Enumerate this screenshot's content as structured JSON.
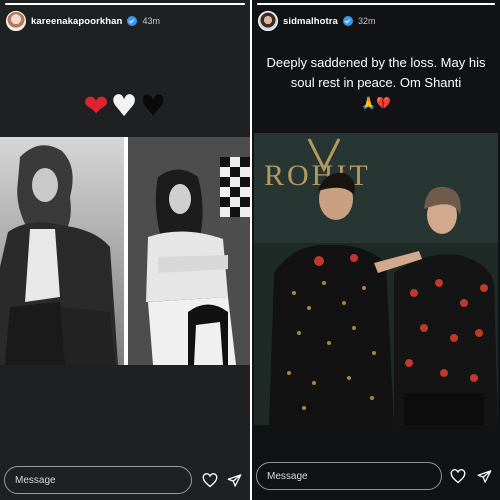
{
  "stories": [
    {
      "username": "kareenakapoorkhan",
      "time": "43m",
      "progress": 1.0,
      "hearts": [
        "❤",
        "♥",
        "♥"
      ],
      "message_placeholder": "Message",
      "icons": [
        "heart-outline-icon",
        "send-icon"
      ]
    },
    {
      "username": "sidmalhotra",
      "time": "32m",
      "progress": 1.0,
      "caption_line1": "Deeply saddened by the loss. May his",
      "caption_line2": "soul rest in peace. Om Shanti",
      "caption_emojis": "🙏💔",
      "backdrop_text": "ROHIT",
      "message_placeholder": "Message",
      "icons": [
        "heart-outline-icon",
        "send-icon"
      ]
    }
  ],
  "colors": {
    "verified": "#3897f0",
    "story_bg_left": "#1f2022",
    "story_bg_right": "#111214"
  }
}
